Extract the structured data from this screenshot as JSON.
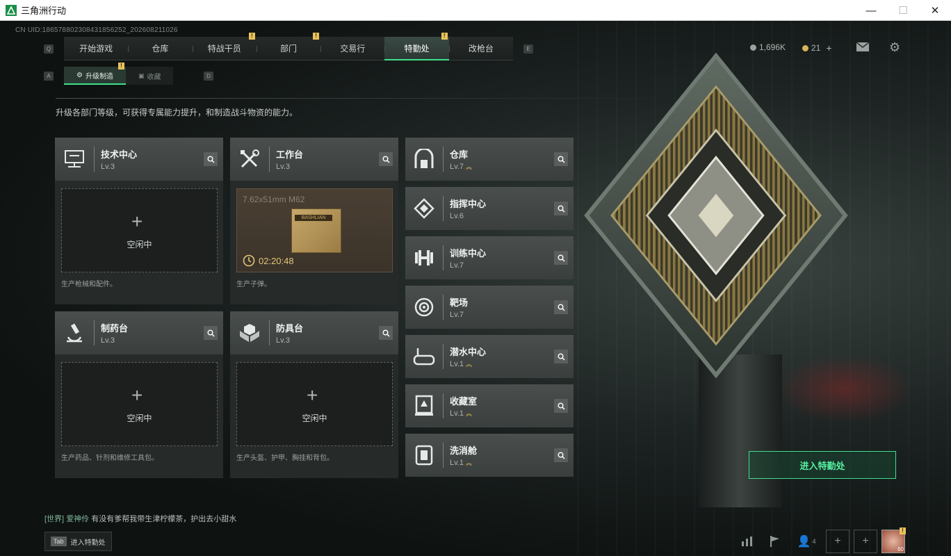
{
  "window": {
    "title": "三角洲行动",
    "minimize": "—",
    "maximize": "☐",
    "close": "✕"
  },
  "uid": "CN UID:1865788023084318562​52_202608211026",
  "nav": {
    "left_key": "Q",
    "right_key": "E",
    "tabs": [
      {
        "label": "开始游戏",
        "badge": ""
      },
      {
        "label": "仓库",
        "badge": ""
      },
      {
        "label": "特战干员",
        "badge": "!"
      },
      {
        "label": "部门",
        "badge": "!"
      },
      {
        "label": "交易行",
        "badge": ""
      },
      {
        "label": "特勤处",
        "badge": "!",
        "active": true
      },
      {
        "label": "改枪台",
        "badge": ""
      }
    ]
  },
  "subnav": {
    "left_key": "A",
    "right_key": "D",
    "tabs": [
      {
        "label": "升级制造",
        "active": true,
        "badge": "!"
      },
      {
        "label": "收藏",
        "active": false
      }
    ]
  },
  "currency": {
    "coins": "1,696K",
    "tickets": "21",
    "add": "+"
  },
  "description": "升级各部门等级，可获得专属能力提升，和制造战斗物资的能力。",
  "workshops": [
    {
      "name": "技术中心",
      "level": "Lv.3",
      "status": "空闲中",
      "footer": "生产枪械和配件。",
      "icon": "computer-icon"
    },
    {
      "name": "工作台",
      "level": "Lv.3",
      "footer": "生产子弹。",
      "icon": "tools-icon",
      "crafting": {
        "item": "7.62x51mm M62",
        "box_label": "BASHLIAN",
        "timer": "02:20:48"
      }
    },
    {
      "name": "制药台",
      "level": "Lv.3",
      "status": "空闲中",
      "footer": "生产药品、针剂和维修工具包。",
      "icon": "microscope-icon"
    },
    {
      "name": "防具台",
      "level": "Lv.3",
      "status": "空闲中",
      "footer": "生产头盔、护甲、胸挂和背包。",
      "icon": "armor-icon"
    }
  ],
  "facilities": [
    {
      "name": "仓库",
      "level": "Lv.7",
      "upgradable": true,
      "icon": "storage-icon"
    },
    {
      "name": "指挥中心",
      "level": "Lv.6",
      "upgradable": false,
      "icon": "command-icon"
    },
    {
      "name": "训练中心",
      "level": "Lv.7",
      "upgradable": false,
      "icon": "dumbbell-icon"
    },
    {
      "name": "靶场",
      "level": "Lv.7",
      "upgradable": false,
      "icon": "target-icon"
    },
    {
      "name": "潜水中心",
      "level": "Lv.1",
      "upgradable": true,
      "icon": "diving-mask-icon"
    },
    {
      "name": "收藏室",
      "level": "Lv.1",
      "upgradable": true,
      "icon": "trophy-case-icon"
    },
    {
      "name": "洗消舱",
      "level": "Lv.1",
      "upgradable": true,
      "icon": "decon-icon"
    }
  ],
  "enter_button": "进入特勤处",
  "chat": {
    "channel": "[世界]",
    "user": "爱神伶",
    "message": "有没有爹帮我带生津柠檬茶，护出去小甜水"
  },
  "tab_hint": {
    "key": "Tab",
    "label": "进入特勤处"
  },
  "bottom": {
    "friends_count": "4",
    "avatar_level": "60"
  },
  "colors": {
    "accent": "#3fe08b",
    "upgrade": "#e8c25a",
    "badge": "#e9c35a"
  }
}
